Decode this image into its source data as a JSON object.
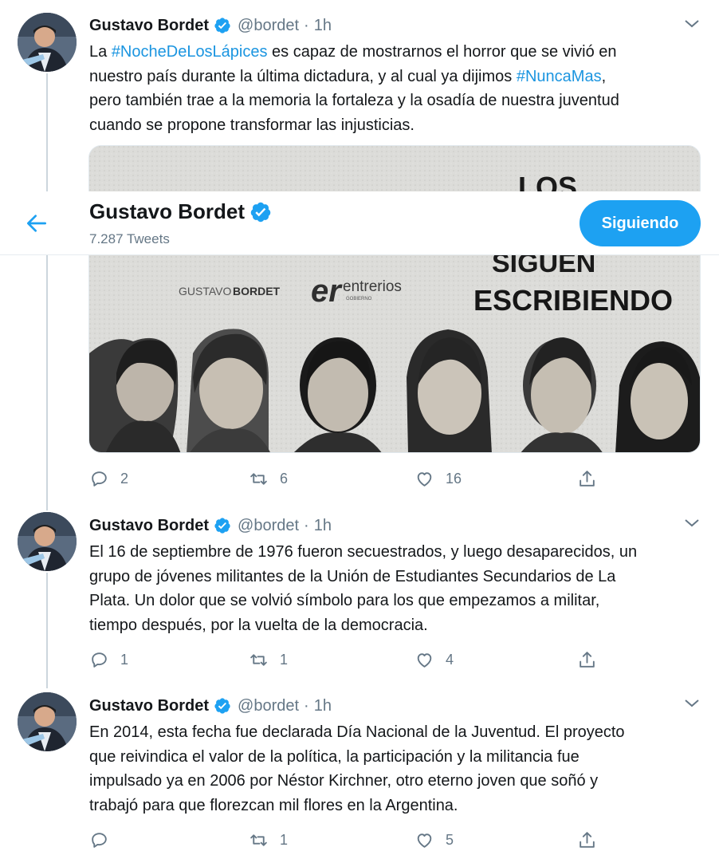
{
  "profile": {
    "name": "Gustavo Bordet",
    "tweet_count": "7.287 Tweets",
    "follow_label": "Siguiendo"
  },
  "colors": {
    "accent": "#1da1f2",
    "hashtag": "#1b95e0",
    "muted": "#657786"
  },
  "tweets": [
    {
      "author": "Gustavo Bordet",
      "handle": "@bordet",
      "separator": "·",
      "time": "1h",
      "lines": [
        [
          {
            "t": "La "
          },
          {
            "t": "#NocheDeLosLápices",
            "tag": true
          },
          {
            "t": " es capaz de mostrarnos el horror que se vivió en"
          }
        ],
        [
          {
            "t": "nuestro país durante la última dictadura, y al cual ya dijimos "
          },
          {
            "t": "#NuncaMas",
            "tag": true
          },
          {
            "t": ","
          }
        ],
        [
          {
            "t": "pero también trae a la memoria la fortaleza y la osadía de nuestra juventud"
          }
        ],
        [
          {
            "t": "cuando se propone transformar las injusticias."
          }
        ]
      ],
      "media": {
        "logo_left_a": "GUSTAVO",
        "logo_left_b": "BORDET",
        "logo_mid_mark": "er",
        "logo_mid_name": "entrerios",
        "logo_mid_sub": "GOBIERNO",
        "headline_top": "LOS",
        "headline_mid": "SIGUEN",
        "headline_bot": "ESCRIBIENDO"
      },
      "replies": "2",
      "retweets": "6",
      "likes": "16"
    },
    {
      "author": "Gustavo Bordet",
      "handle": "@bordet",
      "separator": "·",
      "time": "1h",
      "lines": [
        [
          {
            "t": "El 16 de septiembre de 1976 fueron secuestrados, y luego desaparecidos, un"
          }
        ],
        [
          {
            "t": "grupo de jóvenes militantes de la Unión de Estudiantes Secundarios de La"
          }
        ],
        [
          {
            "t": "Plata. Un dolor que se volvió símbolo para los que empezamos a militar,"
          }
        ],
        [
          {
            "t": "tiempo después, por la vuelta de la democracia."
          }
        ]
      ],
      "replies": "1",
      "retweets": "1",
      "likes": "4"
    },
    {
      "author": "Gustavo Bordet",
      "handle": "@bordet",
      "separator": "·",
      "time": "1h",
      "lines": [
        [
          {
            "t": "En 2014, esta fecha fue declarada Día Nacional de la Juventud. El proyecto"
          }
        ],
        [
          {
            "t": "que reivindica el valor de la política, la participación y la militancia fue"
          }
        ],
        [
          {
            "t": "impulsado ya en 2006 por Néstor Kirchner, otro eterno joven que soñó y"
          }
        ],
        [
          {
            "t": "trabajó para que florezcan mil flores en la Argentina."
          }
        ]
      ],
      "replies": "",
      "retweets": "1",
      "likes": "5"
    }
  ]
}
